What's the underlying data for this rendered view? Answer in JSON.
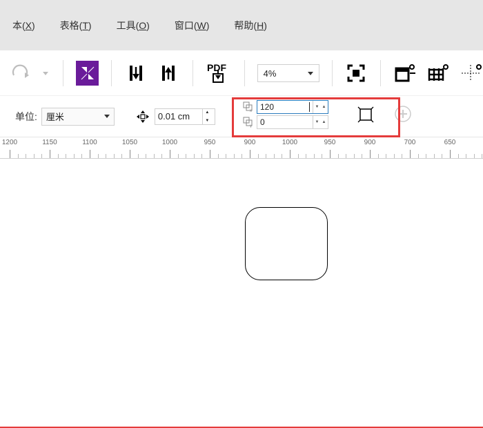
{
  "menu": {
    "items": [
      {
        "prefix": "本(",
        "hot": "X",
        "suffix": ")"
      },
      {
        "prefix": "表格(",
        "hot": "T",
        "suffix": ")"
      },
      {
        "prefix": "工具(",
        "hot": "O",
        "suffix": ")"
      },
      {
        "prefix": "窗口(",
        "hot": "W",
        "suffix": ")"
      },
      {
        "prefix": "帮助(",
        "hot": "H",
        "suffix": ")"
      }
    ]
  },
  "toolbar1": {
    "zoom_value": "4%"
  },
  "toolbar2": {
    "unit_label": "单位:",
    "unit_value": "厘米",
    "nudge_value": "0.01 cm",
    "duplicate": {
      "x_value": "120",
      "y_value": "0"
    }
  },
  "ruler": {
    "ticks": [
      1200,
      1150,
      1100,
      1050,
      1000,
      950,
      900,
      1000,
      950,
      900,
      700,
      650
    ]
  },
  "canvas": {
    "shape": "rounded-rectangle"
  }
}
